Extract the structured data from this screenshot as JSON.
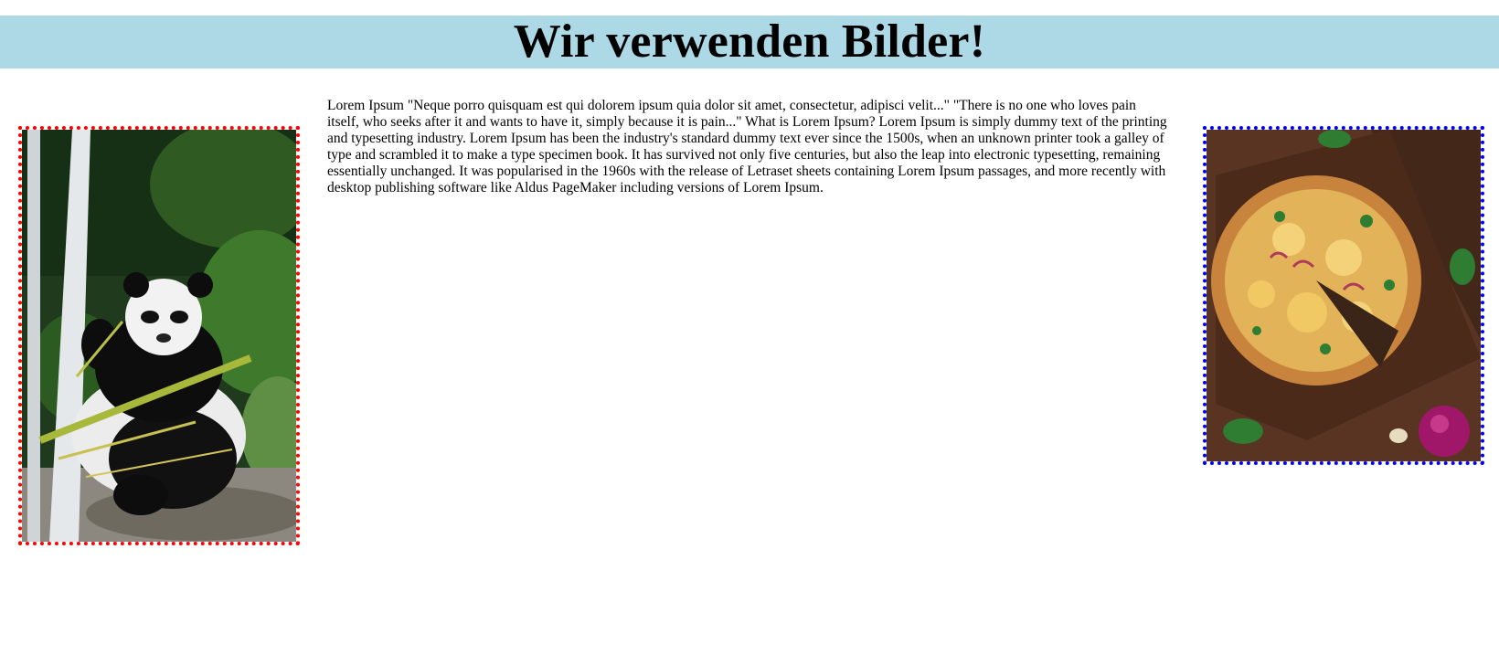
{
  "header": {
    "title": "Wir verwenden Bilder!",
    "background": "#add8e6"
  },
  "images": {
    "left": {
      "subject": "panda eating bamboo",
      "icon": "panda-photo",
      "border_color": "#ff0000"
    },
    "right": {
      "subject": "pizza on wooden board",
      "icon": "pizza-photo",
      "border_color": "#0000ff"
    }
  },
  "content": {
    "paragraph": "Lorem Ipsum \"Neque porro quisquam est qui dolorem ipsum quia dolor sit amet, consectetur, adipisci velit...\" \"There is no one who loves pain itself, who seeks after it and wants to have it, simply because it is pain...\" What is Lorem Ipsum? Lorem Ipsum is simply dummy text of the printing and typesetting industry. Lorem Ipsum has been the industry's standard dummy text ever since the 1500s, when an unknown printer took a galley of type and scrambled it to make a type specimen book. It has survived not only five centuries, but also the leap into electronic typesetting, remaining essentially unchanged. It was popularised in the 1960s with the release of Letraset sheets containing Lorem Ipsum passages, and more recently with desktop publishing software like Aldus PageMaker including versions of Lorem Ipsum."
  }
}
